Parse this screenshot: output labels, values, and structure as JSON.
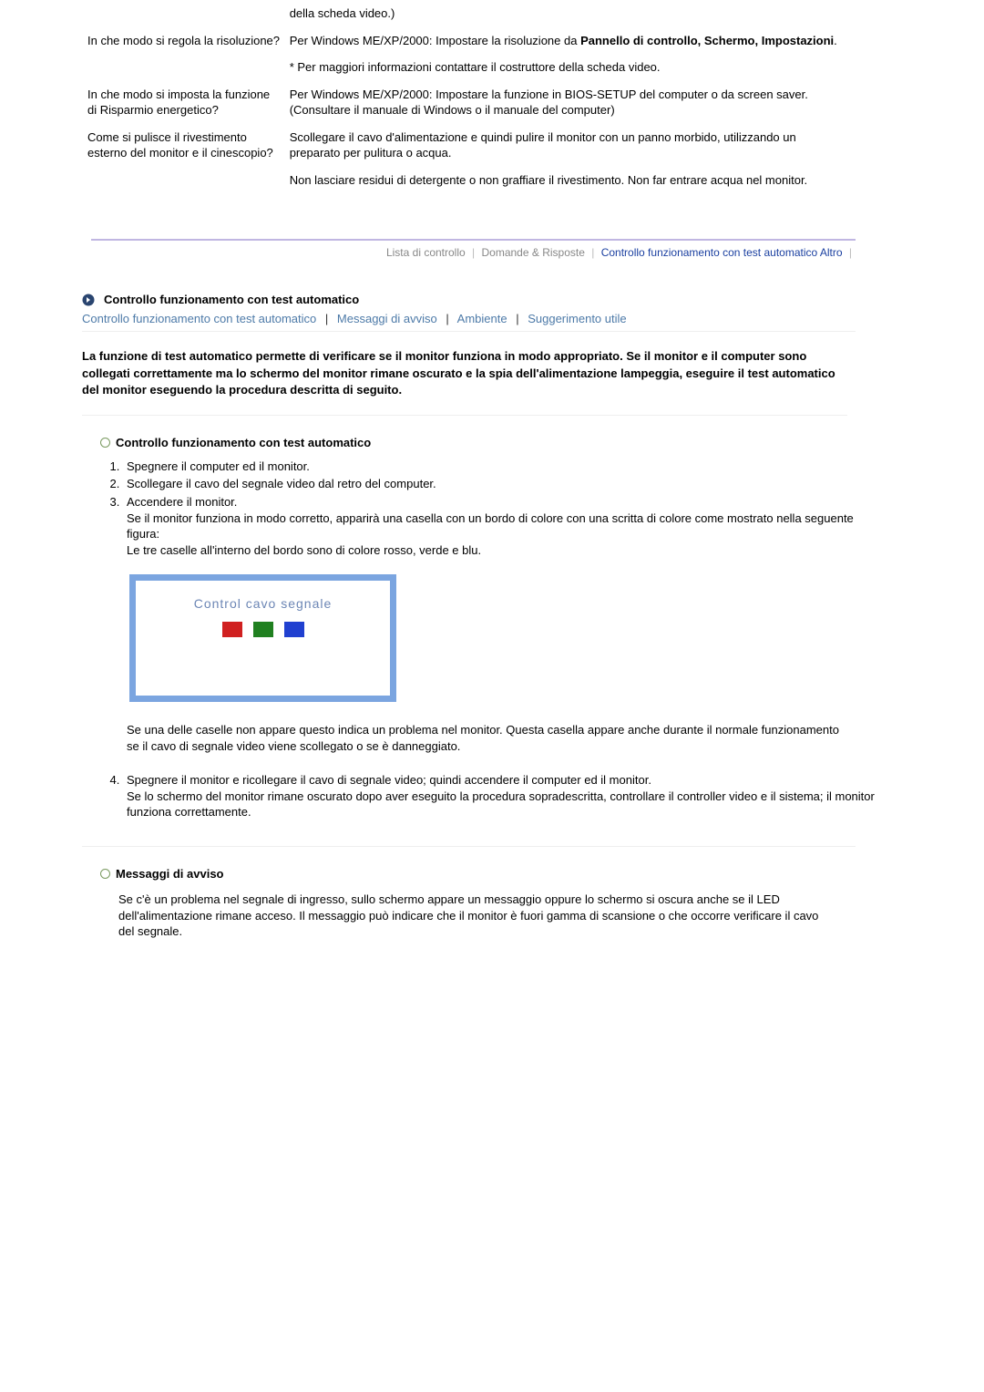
{
  "faq": {
    "row0": {
      "answer_tail": "della scheda video.)"
    },
    "row1": {
      "question": "In che modo si regola la risoluzione?",
      "answer_line1_pre": "Per Windows ME/XP/2000: Impostare la risoluzione da ",
      "answer_line1_bold": "Pannello di controllo, Schermo, Impostazioni",
      "answer_line1_post": ".",
      "answer_line2": "* Per maggiori informazioni contattare il costruttore della scheda video."
    },
    "row2": {
      "question": "In che modo si imposta la funzione di Risparmio energetico?",
      "answer": "Per Windows ME/XP/2000: Impostare la funzione in BIOS-SETUP del computer o da screen saver. (Consultare il manuale di Windows o il manuale del computer)"
    },
    "row3": {
      "question": "Come si pulisce il rivestimento esterno del monitor e il cinescopio?",
      "answer1": "Scollegare il cavo d'alimentazione e quindi pulire il monitor con un panno morbido, utilizzando un preparato per pulitura o acqua.",
      "answer2": "Non lasciare residui di detergente o non graffiare il rivestimento. Non far entrare acqua nel monitor."
    }
  },
  "section_tabs": {
    "t1": "Lista di controllo",
    "t2": "Domande & Risposte",
    "t3": "Controllo funzionamento con test automatico Altro"
  },
  "main_heading": "Controllo funzionamento con test automatico",
  "sub_links": {
    "l1": "Controllo funzionamento con test automatico",
    "l2": "Messaggi di avviso",
    "l3": "Ambiente",
    "l4": "Suggerimento utile"
  },
  "intro_bold": "La funzione di test automatico permette di verificare se il monitor funziona in modo appropriato. Se il monitor e il computer sono collegati correttamente ma lo schermo del monitor rimane oscurato e la spia dell'alimentazione lampeggia, eseguire il test automatico del monitor eseguendo la procedura descritta di seguito.",
  "subheading1": "Controllo funzionamento con test automatico",
  "steps": {
    "s1": "Spegnere il computer ed il monitor.",
    "s2": "Scollegare il cavo del segnale video dal retro del computer.",
    "s3a": "Accendere il monitor.",
    "s3b": "Se il monitor funziona in modo corretto, apparirà una casella con un bordo di colore con una scritta di colore come mostrato nella seguente figura:",
    "s3c": "Le tre caselle all'interno del bordo sono di colore rosso, verde e blu.",
    "s3_box_label": "Control cavo segnale",
    "s3d": "Se una delle caselle non appare questo indica un problema nel monitor. Questa casella appare anche durante il normale funzionamento se il cavo di segnale video viene scollegato o se è danneggiato.",
    "s4a": "Spegnere il monitor e ricollegare il cavo di segnale video; quindi accendere il computer ed il monitor.",
    "s4b": "Se lo schermo del monitor rimane oscurato dopo aver eseguito la procedura sopradescritta, controllare il controller video e il sistema; il monitor funziona correttamente."
  },
  "subheading2": "Messaggi di avviso",
  "avviso_body": "Se c'è un problema nel segnale di ingresso, sullo schermo appare un messaggio oppure lo schermo si oscura anche se il LED dell'alimentazione rimane acceso. Il messaggio può indicare che il monitor è fuori gamma di scansione o che occorre verificare il cavo del segnale."
}
